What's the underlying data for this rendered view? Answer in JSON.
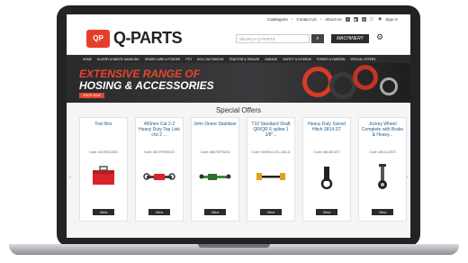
{
  "top_links": [
    "Catalogues",
    "Contact Us",
    "About Us",
    "Sign in"
  ],
  "social_icons": [
    "facebook-icon",
    "youtube-icon",
    "instagram-icon",
    "cart-icon",
    "user-icon"
  ],
  "logo": {
    "badge": "QP",
    "text": "Q-PARTS"
  },
  "search": {
    "placeholder": "SEARCH Q-PARTS"
  },
  "machinery_label": "MACHINERY",
  "nav": [
    "HOME",
    "SLURRY & WASTE HANDLING",
    "GRASS CARE & FODDER",
    "PTO",
    "SOIL CULTIVATION",
    "TRACTOR & TRAILER",
    "GARAGE",
    "SAFETY & HYGIENE",
    "FOREST & GARDEN",
    "SPECIAL OFFERS"
  ],
  "banner": {
    "title": "EXTENSIVE RANGE OF",
    "subtitle": "HOSING & ACCESSORIES",
    "button": "SHOP NOW"
  },
  "offers_title": "Special Offers",
  "products": [
    {
      "name": "Tool Box",
      "code": "Code: ABI-RBC4002",
      "view": "View"
    },
    {
      "name": "460mm Cat 2-2 Heavy Duty Top Link c/w 2 ...",
      "code": "Code: ABI-RTBH0022",
      "view": "View"
    },
    {
      "name": "John Deere Stabiliser",
      "code": "Code: ABI-RWTB203",
      "view": "View"
    },
    {
      "name": "T10 Standard Shaft QR/QR 6 spline 1 3/8\"...",
      "code": "Code: EDM061-103-1AB-11",
      "view": "View"
    },
    {
      "name": "Heavy Duty Swivel Hitch 3814.ST",
      "code": "Code: ABI-3814ST",
      "view": "View"
    },
    {
      "name": "Jockey Wheel Complete with Brake & Heavy...",
      "code": "Code: ABI-AC2570",
      "view": "View"
    }
  ]
}
